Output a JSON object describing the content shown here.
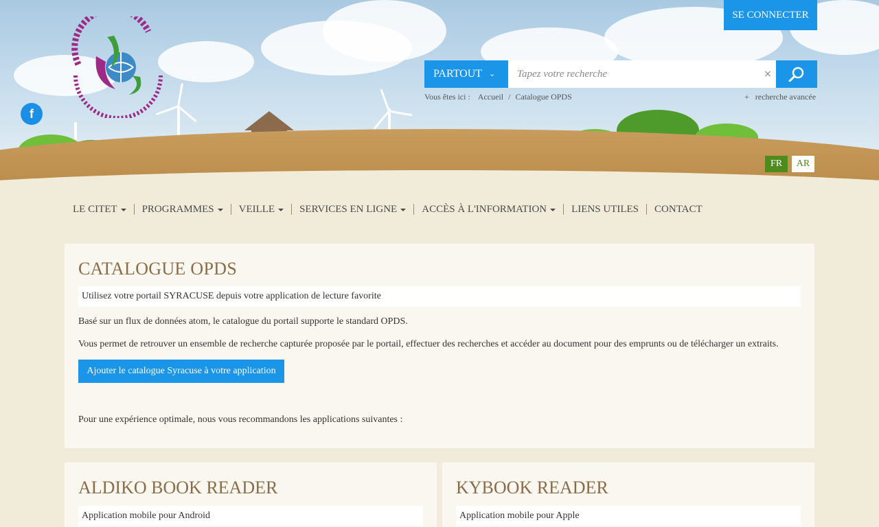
{
  "header": {
    "connect_label": "SE CONNECTER",
    "logo_alt": "Centre International des Technologies de l'Environnement de Tunis",
    "social": {
      "facebook_icon": "f"
    }
  },
  "search": {
    "scope_label": "PARTOUT",
    "placeholder": "Tapez votre recherche",
    "clear_icon": "×",
    "submit_icon": "search-icon"
  },
  "breadcrumb": {
    "prefix": "Vous êtes ici :",
    "items": [
      "Accueil",
      "/",
      "Catalogue OPDS"
    ]
  },
  "advanced_search": {
    "plus": "+",
    "label": "recherche avancée"
  },
  "languages": {
    "fr": "FR",
    "ar": "AR",
    "active": "FR"
  },
  "nav": {
    "items": [
      {
        "label": "LE CITET",
        "dropdown": true
      },
      {
        "label": "PROGRAMMES",
        "dropdown": true
      },
      {
        "label": "VEILLE",
        "dropdown": true
      },
      {
        "label": "SERVICES EN LIGNE",
        "dropdown": true
      },
      {
        "label": "ACCÈS À L'INFORMATION",
        "dropdown": true
      },
      {
        "label": "LIENS UTILES",
        "dropdown": false
      },
      {
        "label": "CONTACT",
        "dropdown": false
      }
    ]
  },
  "main": {
    "title": "CATALOGUE OPDS",
    "subtitle": "Utilisez votre portail SYRACUSE depuis votre application de lecture favorite",
    "para1": "Basé sur un flux de données atom, le catalogue du portail supporte le standard OPDS.",
    "para2": "Vous permet de retrouver un ensemble de recherche capturée proposée par le portail, effectuer des recherches et accéder au document pour des emprunts ou de télécharger un extraits.",
    "add_button": "Ajouter le catalogue Syracuse à votre application",
    "para3": "Pour une expérience optimale, nous vous recommandons les applications suivantes :"
  },
  "apps": [
    {
      "title": "ALDIKO BOOK READER",
      "subtitle": "Application mobile pour Android"
    },
    {
      "title": "KYBOOK READER",
      "subtitle": "Application mobile pour Apple"
    }
  ],
  "colors": {
    "accent": "#1a95e7",
    "title_brown": "#8a6d48",
    "lang_green": "#4e8a1c",
    "background": "#f1ecda"
  }
}
